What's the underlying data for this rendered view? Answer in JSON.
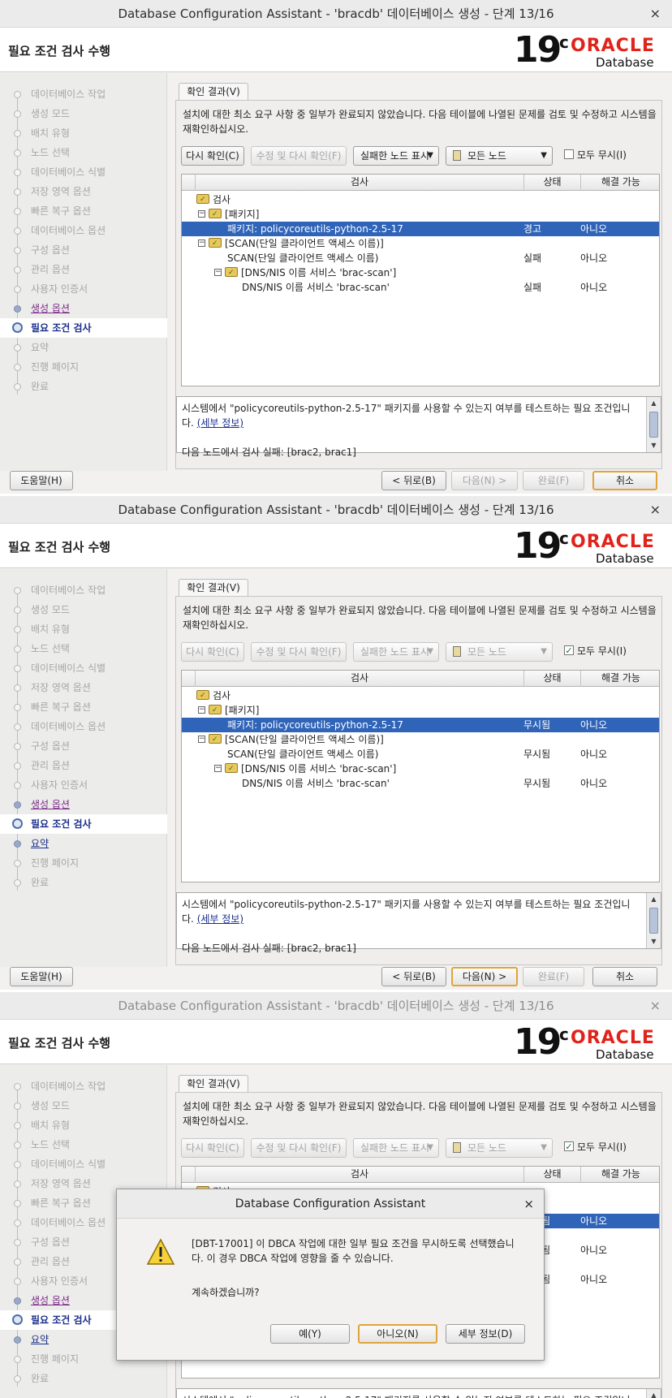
{
  "window": {
    "title": "Database Configuration Assistant - 'bracdb' 데이터베이스 생성 - 단계 13/16",
    "close_symbol": "×",
    "page_title": "필요 조건 검사 수행",
    "logo": {
      "version": "19",
      "version_suffix": "c",
      "brand": "ORACLE",
      "product": "Database",
      "brand_color": "#e2231a"
    }
  },
  "nav_items": [
    "데이터베이스 작업",
    "생성 모드",
    "배치 유형",
    "노드 선택",
    "데이터베이스 식별",
    "저장 영역 옵션",
    "빠른 복구 옵션",
    "데이터베이스 옵션",
    "구성 옵션",
    "관리 옵션",
    "사용자 인증서",
    "생성 옵션",
    "필요 조건 검사",
    "요약",
    "진행 페이지",
    "완료"
  ],
  "tab_label": "확인 결과(V)",
  "message": "설치에 대한 최소 요구 사항 중 일부가 완료되지 않았습니다. 다음 테이블에 나열된 문제를 검토 및 수정하고 시스템을 재확인하십시오.",
  "toolbar": {
    "recheck": "다시 확인(C)",
    "fix_recheck": "수정 및 다시 확인(F)",
    "show_failed": "실패한 노드 표시",
    "all_nodes": "모든 노드",
    "ignore_all": "모두 무시(I)"
  },
  "table": {
    "columns": [
      "검사",
      "상태",
      "해결 가능"
    ],
    "rows": [
      {
        "label": "검사"
      },
      {
        "label": "[패키지]"
      },
      {
        "label": "패키지: policycoreutils-python-2.5-17",
        "fix": "아니오"
      },
      {
        "label": "[SCAN(단일 클라이언트 액세스 이름)]"
      },
      {
        "label": "SCAN(단일 클라이언트 액세스 이름)",
        "fix": "아니오"
      },
      {
        "label": "[DNS/NIS 이름 서비스 'brac-scan']"
      },
      {
        "label": "DNS/NIS 이름 서비스 'brac-scan'",
        "fix": "아니오"
      }
    ]
  },
  "status": {
    "warning": "경고",
    "fail": "실패",
    "ignored": "무시됨"
  },
  "description": {
    "text": "시스템에서 \"policycoreutils-python-2.5-17\" 패키지를 사용할 수 있는지 여부를 테스트하는 필요 조건입니다.",
    "link": "(세부 정보)",
    "failed_nodes": "다음 노드에서 검사 실패: [brac2, brac1]"
  },
  "footer": {
    "help": "도움말(H)",
    "back": "< 뒤로(B)",
    "next": "다음(N) >",
    "finish": "완료(F)",
    "cancel": "취소"
  },
  "dialog": {
    "title": "Database Configuration Assistant",
    "message": "[DBT-17001] 이 DBCA 작업에 대한 일부 필요 조건을 무시하도록 선택했습니다. 이 경우 DBCA 작업에 영향을 줄 수 있습니다.",
    "question": "계속하겠습니까?",
    "yes": "예(Y)",
    "no": "아니오(N)",
    "details": "세부 정보(D)"
  },
  "colors": {
    "selection": "#2f64b8",
    "default_button_border": "#e0a43c",
    "link": "#1c2f8c",
    "visited_link": "#7b2b88"
  }
}
